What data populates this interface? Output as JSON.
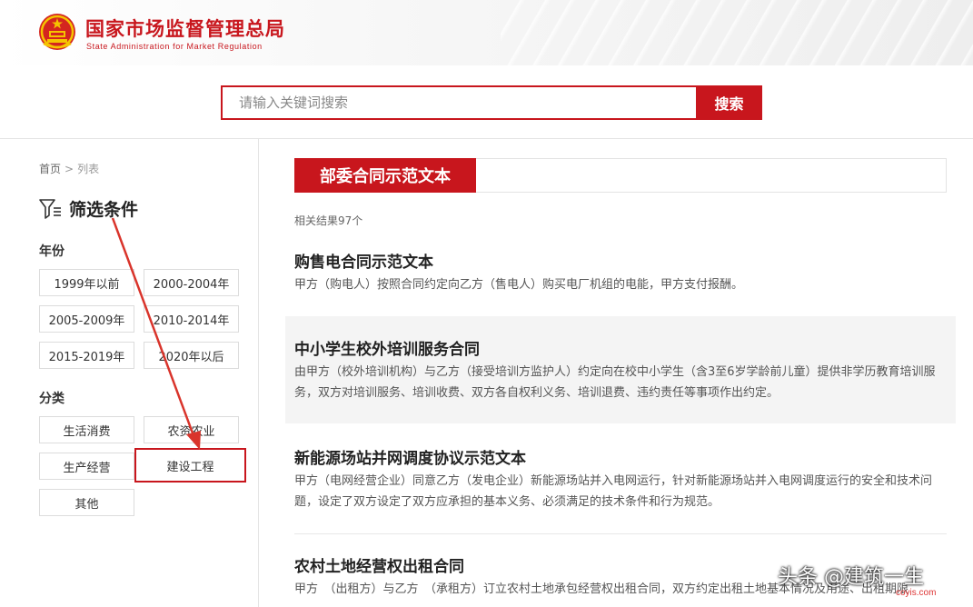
{
  "header": {
    "title_cn": "国家市场监督管理总局",
    "title_en": "State Administration for Market Regulation",
    "emblem_icon": "national-emblem-icon"
  },
  "search": {
    "placeholder": "请输入关键词搜索",
    "value": "",
    "button_label": "搜索"
  },
  "breadcrumb": {
    "home": "首页",
    "separator": ">",
    "current": "列表"
  },
  "filter": {
    "title": "筛选条件",
    "icon": "filter-icon",
    "year_label": "年份",
    "years": [
      "1999年以前",
      "2000-2004年",
      "2005-2009年",
      "2010-2014年",
      "2015-2019年",
      "2020年以后"
    ],
    "category_label": "分类",
    "categories": [
      "生活消费",
      "农资农业",
      "生产经营",
      "建设工程",
      "其他"
    ],
    "highlighted_category": "建设工程"
  },
  "main": {
    "category_title": "部委合同示范文本",
    "result_count": "相关结果97个",
    "items": [
      {
        "title": "购售电合同示范文本",
        "desc": "甲方（购电人）按照合同约定向乙方（售电人）购买电厂机组的电能，甲方支付报酬。"
      },
      {
        "title": "中小学生校外培训服务合同",
        "desc": "由甲方（校外培训机构）与乙方（接受培训方监护人）约定向在校中小学生（含3至6岁学龄前儿童）提供非学历教育培训服务，双方对培训服务、培训收费、双方各自权利义务、培训退费、违约责任等事项作出约定。"
      },
      {
        "title": "新能源场站并网调度协议示范文本",
        "desc": "甲方（电网经营企业）同意乙方（发电企业）新能源场站并入电网运行，针对新能源场站并入电网调度运行的安全和技术问题，设定了双方设定了双方应承担的基本义务、必须满足的技术条件和行为规范。"
      },
      {
        "title": "农村土地经营权出租合同",
        "desc": "甲方　（出租方）与乙方　（承租方）订立农村土地承包经营权出租合同，双方约定出租土地基本情况及用途、出租期限"
      }
    ]
  },
  "watermark": {
    "text": "头条 @建筑一生",
    "small": "coyis.com"
  },
  "colors": {
    "brand_red": "#c8161d",
    "annotation_red": "#d9342b"
  }
}
